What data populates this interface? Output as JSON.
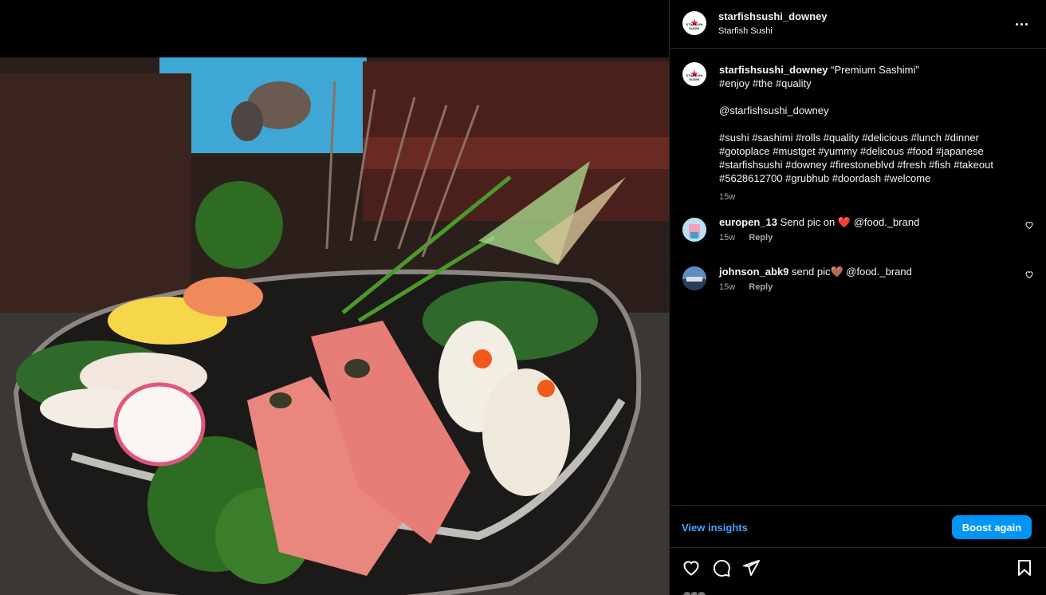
{
  "post": {
    "username": "starfishsushi_downey",
    "location": "Starfish Sushi",
    "avatar_brand": "STARFISH SUSHI"
  },
  "caption": {
    "username": "starfishsushi_downey",
    "title": "“Premium Sashimi”",
    "line2": "#enjoy #the #quality",
    "mention": "@starfishsushi_downey",
    "tags_line1": "#sushi #sashimi #rolls #quality #delicious #lunch #dinner",
    "tags_line2": "#gotoplace #mustget #yummy #delicous #food #japanese",
    "tags_line3": "#starfishsushi #downey #firestoneblvd #fresh #fish #takeout",
    "tags_line4": "#5628612700 #grubhub #doordash #welcome",
    "time": "15w"
  },
  "comments": [
    {
      "username": "europen_13",
      "text": "Send pic on",
      "emoji": "❤️",
      "mention": "@food._brand",
      "time": "15w",
      "reply_label": "Reply"
    },
    {
      "username": "johnson_abk9",
      "text": "send pic",
      "emoji": "🤎",
      "mention": "@food._brand",
      "time": "15w",
      "reply_label": "Reply"
    }
  ],
  "footer": {
    "view_insights_label": "View insights",
    "boost_label": "Boost again"
  },
  "icons": {
    "more": "more-horizontal-icon",
    "like": "heart-icon",
    "comment": "comment-bubble-icon",
    "share": "paper-plane-icon",
    "save": "bookmark-icon"
  },
  "colors": {
    "accent_blue": "#0095f6",
    "link_blue": "#4aa3ff",
    "heart_red": "#ff3040",
    "divider": "#262626"
  }
}
